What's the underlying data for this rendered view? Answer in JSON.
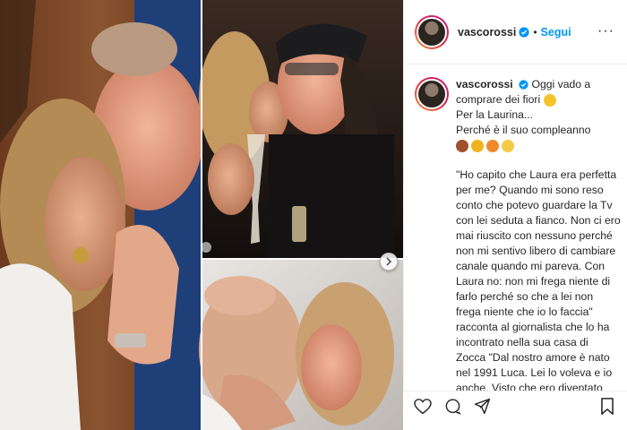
{
  "post": {
    "username": "vascorossi",
    "follow_label": "Segui",
    "more_icon": "more-options-icon",
    "verified_color": "#0095f6",
    "follow_color": "#0095f6"
  },
  "caption": {
    "username": "vascorossi",
    "line1": "Oggi vado a comprare dei fiori",
    "line2": "Per la Laurina...",
    "line3": "Perché è il suo compleanno",
    "quote": "\"Ho capito che Laura era perfetta per me? Quando mi sono reso conto che potevo guardare la Tv con lei seduta a fianco. Non ci ero mai riuscito con nessuno perché non mi sentivo libero di cambiare canale quando mi pareva. Con Laura no: non mi frega niente di farlo perché so che a lei non frega niente che io lo faccia\" racconta al giornalista che lo ha incontrato nella sua casa di Zocca \"Dal nostro amore è nato nel 1991 Luca. Lei lo voleva e io anche. Visto che ero diventato padre"
  },
  "actions": {
    "like_icon": "heart-icon",
    "comment_icon": "comment-icon",
    "share_icon": "share-icon",
    "save_icon": "bookmark-icon"
  },
  "carousel": {
    "next_icon": "chevron-right-icon"
  }
}
